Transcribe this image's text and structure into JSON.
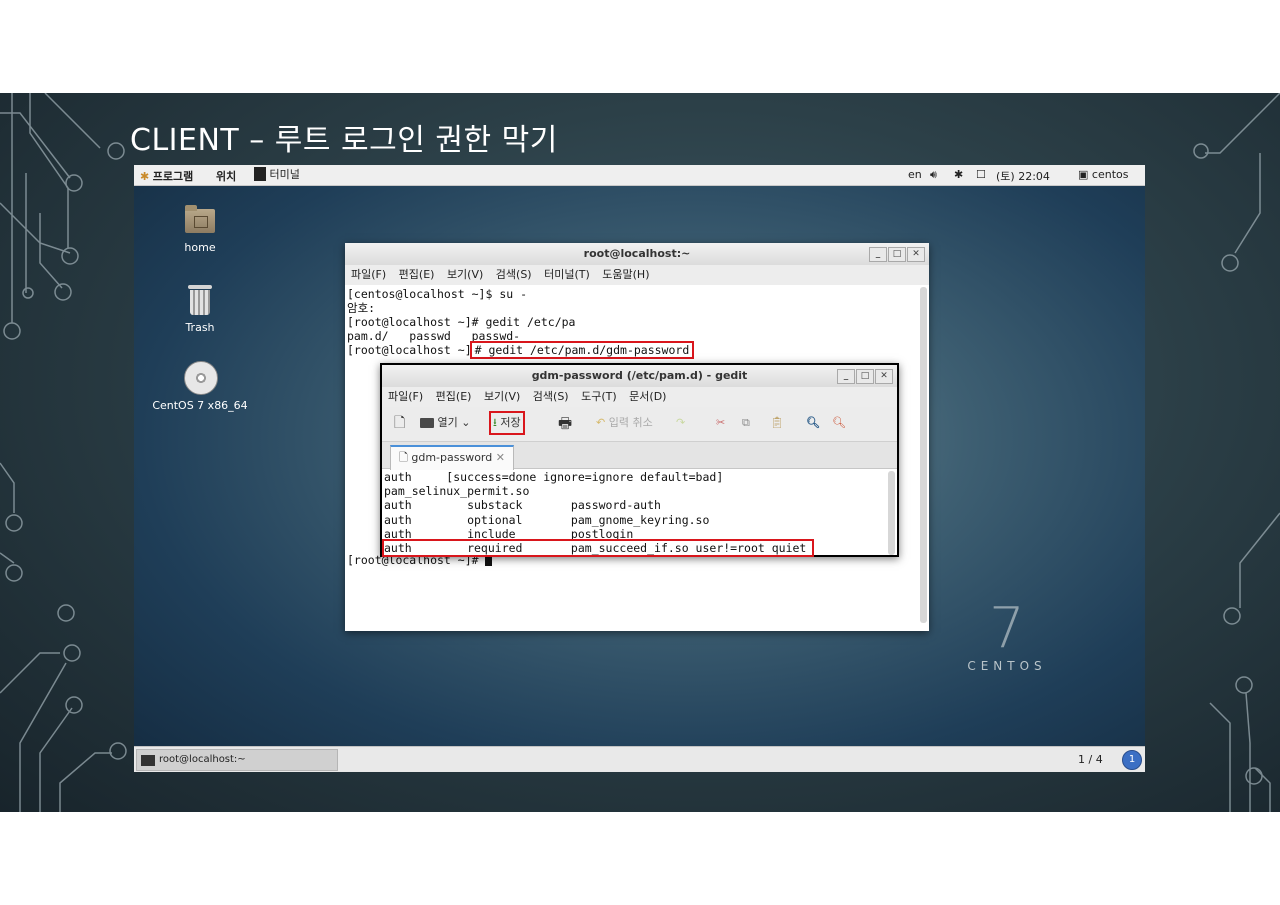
{
  "slide": {
    "title": "CLIENT – 루트 로그인 권한 막기"
  },
  "topbar": {
    "apps": "프로그램",
    "places": "위치",
    "terminal": "터미널",
    "lang": "en",
    "volume_icon": "volume-icon",
    "bluetooth_icon": "bluetooth-icon",
    "network_icon": "network-icon",
    "clock": "(토) 22:04",
    "user": "centos"
  },
  "desktop": {
    "icons": [
      {
        "label": "home",
        "icon": "home-folder-icon"
      },
      {
        "label": "Trash",
        "icon": "trash-icon"
      },
      {
        "label": "CentOS 7 x86_64",
        "icon": "disc-icon"
      }
    ],
    "watermark_number": "7",
    "watermark_text": "CENTOS"
  },
  "terminal": {
    "title": "root@localhost:~",
    "menu": [
      "파일(F)",
      "편집(E)",
      "보기(V)",
      "검색(S)",
      "터미널(T)",
      "도움말(H)"
    ],
    "lines": [
      "[centos@localhost ~]$ su -",
      "암호:",
      "[root@localhost ~]# gedit /etc/pa",
      "pam.d/   passwd   passwd-"
    ],
    "prompt_highlight_prefix": "[root@localhost ~]",
    "highlight_cmd": "# gedit /etc/pam.d/gdm-password",
    "final_prompt": "[root@localhost ~]# "
  },
  "gedit": {
    "title": "gdm-password (/etc/pam.d) - gedit",
    "menu": [
      "파일(F)",
      "편집(E)",
      "보기(V)",
      "검색(S)",
      "도구(T)",
      "문서(D)"
    ],
    "toolbar": {
      "open": "열기",
      "save": "저장",
      "undo": "입력 취소"
    },
    "tab": "gdm-password",
    "lines": [
      "auth     [success=done ignore=ignore default=bad]",
      "pam_selinux_permit.so",
      "auth        substack       password-auth",
      "auth        optional       pam_gnome_keyring.so",
      "auth        include        postlogin"
    ],
    "highlight_line": "auth        required       pam_succeed_if.so user!=root quiet"
  },
  "bottombar": {
    "task": "root@localhost:~",
    "workspace": "1 / 4",
    "notif": "1"
  }
}
